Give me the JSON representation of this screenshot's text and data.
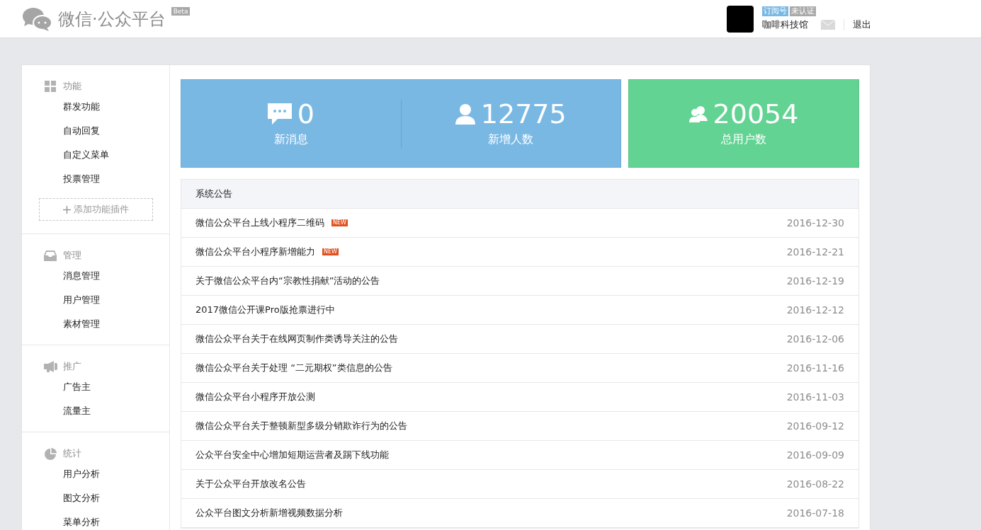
{
  "header": {
    "logo_text": "微信·公众平台",
    "beta": "Beta",
    "account_type": "订阅号",
    "verification": "未认证",
    "account_name": "咖啡科技馆",
    "logout": "退出"
  },
  "sidebar": [
    {
      "kind": "grid",
      "title": "功能",
      "items": [
        "群发功能",
        "自动回复",
        "自定义菜单",
        "投票管理"
      ],
      "add_button": "添加功能插件"
    },
    {
      "kind": "inbox",
      "title": "管理",
      "items": [
        "消息管理",
        "用户管理",
        "素材管理"
      ]
    },
    {
      "kind": "megaphone",
      "title": "推广",
      "items": [
        "广告主",
        "流量主"
      ]
    },
    {
      "kind": "pie",
      "title": "统计",
      "items": [
        "用户分析",
        "图文分析",
        "菜单分析"
      ]
    }
  ],
  "stats": [
    {
      "kind": "message",
      "value": "0",
      "label": "新消息"
    },
    {
      "kind": "user",
      "value": "12775",
      "label": "新增人数"
    },
    {
      "kind": "users",
      "value": "20054",
      "label": "总用户数"
    }
  ],
  "notices": {
    "title": "系统公告",
    "rows": [
      {
        "title": "微信公众平台上线小程序二维码",
        "badge": "NEW",
        "date": "2016-12-30"
      },
      {
        "title": "微信公众平台小程序新增能力",
        "badge": "NEW",
        "date": "2016-12-21"
      },
      {
        "title": "关于微信公众平台内“宗教性捐献”活动的公告",
        "date": "2016-12-19"
      },
      {
        "title": "2017微信公开课Pro版抢票进行中",
        "date": "2016-12-12"
      },
      {
        "title": "微信公众平台关于在线网页制作类诱导关注的公告",
        "date": "2016-12-06"
      },
      {
        "title": "微信公众平台关于处理 “二元期权”类信息的公告",
        "date": "2016-11-16"
      },
      {
        "title": "微信公众平台小程序开放公测",
        "date": "2016-11-03"
      },
      {
        "title": "微信公众平台关于整顿新型多级分销欺诈行为的公告",
        "date": "2016-09-12"
      },
      {
        "title": "公众平台安全中心增加短期运营者及踢下线功能",
        "date": "2016-09-09"
      },
      {
        "title": "关于公众平台开放改名公告",
        "date": "2016-08-22"
      },
      {
        "title": "公众平台图文分析新增视频数据分析",
        "date": "2016-07-18"
      }
    ]
  }
}
